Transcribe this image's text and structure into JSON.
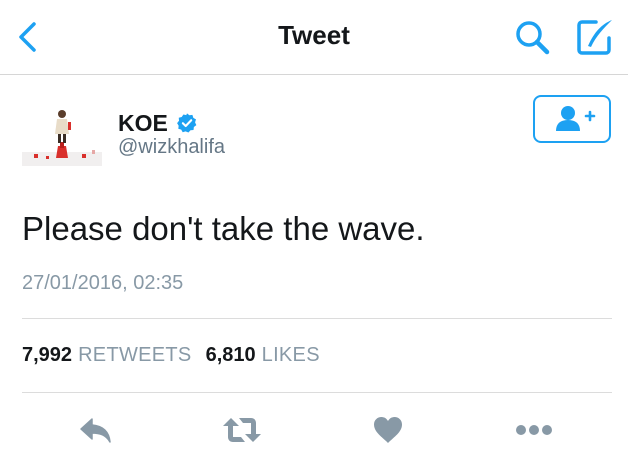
{
  "nav": {
    "title": "Tweet",
    "icons": {
      "back": "chevron-left-icon",
      "search": "search-icon",
      "compose": "compose-icon"
    }
  },
  "author": {
    "display_name": "KOE",
    "handle": "@wizkhalifa",
    "verified": true
  },
  "tweet": {
    "text": "Please don't take the wave.",
    "timestamp": "27/01/2016, 02:35"
  },
  "stats": {
    "retweets_count": "7,992",
    "retweets_label": "RETWEETS",
    "likes_count": "6,810",
    "likes_label": "LIKES"
  },
  "actions": [
    "reply-icon",
    "retweet-icon",
    "like-icon",
    "more-icon"
  ],
  "colors": {
    "accent": "#1da1f2",
    "action_gray": "#8899a6",
    "text": "#14171a",
    "secondary_text": "#657786"
  }
}
